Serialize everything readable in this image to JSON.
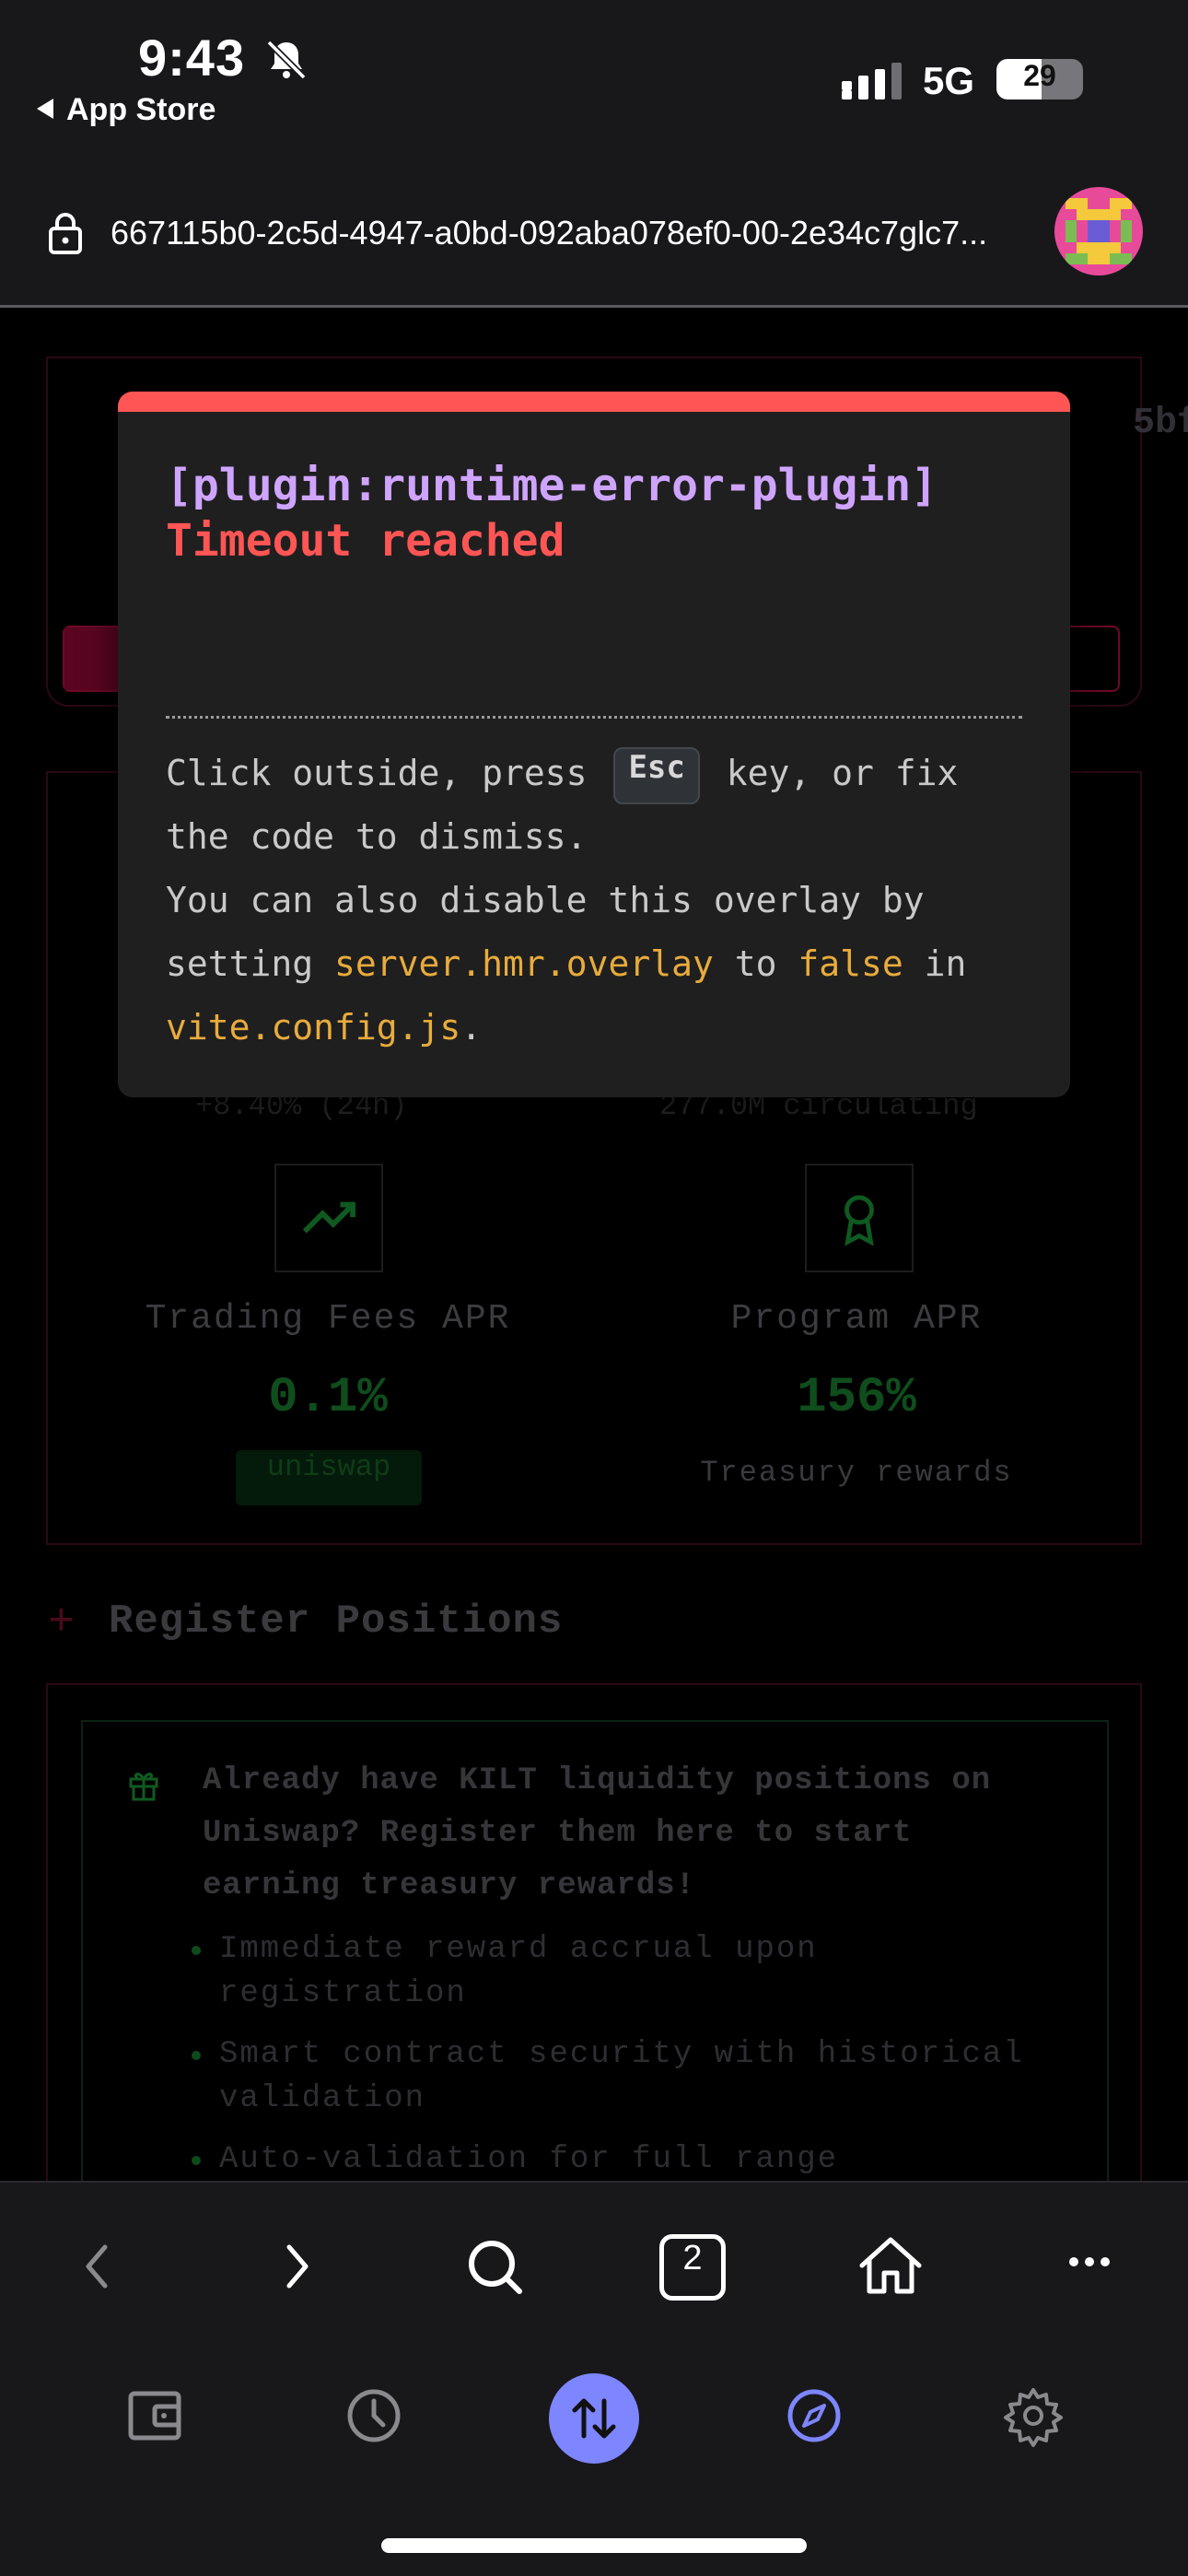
{
  "status_bar": {
    "time": "9:43",
    "back_app": "App Store",
    "network": "5G",
    "battery": "29"
  },
  "browser": {
    "url": "667115b0-2c5d-4947-a0bd-092aba078ef0-00-2e34c7glc7...",
    "tab_count": "2"
  },
  "page": {
    "ghost_right": "5bf",
    "stats": {
      "left_sub": "+8.40% (24h)",
      "right_sub": "277.0M circulating",
      "trading_label": "Trading Fees APR",
      "trading_value": "0.1%",
      "trading_badge": "uniswap",
      "program_label": "Program APR",
      "program_value": "156%",
      "program_note": "Treasury rewards"
    },
    "register": {
      "plus": "+",
      "title": "Register Positions",
      "headline": "Already have KILT liquidity positions on Uniswap? Register them here to start earning treasury rewards!",
      "bullets": [
        "Immediate reward accrual upon registration",
        "Smart contract security with historical validation",
        "Auto-validation for full range"
      ]
    }
  },
  "error_overlay": {
    "plugin": "[plugin:runtime-error-plugin]",
    "message": "Timeout reached",
    "tip_1a": "Click outside, press ",
    "tip_key": "Esc",
    "tip_1b": " key, or fix the code to dismiss.",
    "tip_2a": "You can also disable this overlay by setting ",
    "tip_code_1": "server.hmr.overlay",
    "tip_2b": " to ",
    "tip_code_2": "false",
    "tip_2c": " in ",
    "tip_code_3": "vite.config.js",
    "tip_2d": "."
  },
  "icons": {
    "bell": "bell-slash-icon",
    "lock": "lock-icon",
    "back": "chevron-left-icon",
    "forward": "chevron-right-icon",
    "search": "search-icon",
    "home": "home-icon",
    "more": "more-icon",
    "wallet": "wallet-icon",
    "history": "clock-icon",
    "swap": "swap-icon",
    "discover": "compass-icon",
    "settings": "gear-icon"
  },
  "colors": {
    "overlay_accent": "#ff5555",
    "plugin_text": "#cfa4ff",
    "code_text": "#e8ab3d",
    "swap_button": "#7d86ff"
  }
}
